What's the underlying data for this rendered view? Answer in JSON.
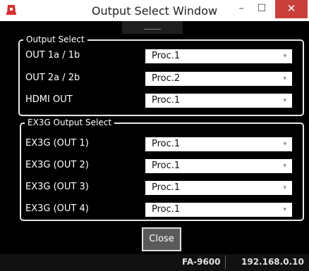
{
  "window": {
    "title": "Output Select Window",
    "controls": {
      "minimize": "–",
      "maximize": "☐",
      "close": "✕"
    }
  },
  "output_select": {
    "legend": "Output Select",
    "rows": [
      {
        "label": "OUT 1a / 1b",
        "value": "Proc.1"
      },
      {
        "label": "OUT 2a / 2b",
        "value": "Proc.2"
      },
      {
        "label": "HDMI OUT",
        "value": "Proc.1"
      }
    ]
  },
  "ex3g_output_select": {
    "legend": "EX3G Output Select",
    "rows": [
      {
        "label": "EX3G (OUT 1)",
        "value": "Proc.1"
      },
      {
        "label": "EX3G (OUT 2)",
        "value": "Proc.1"
      },
      {
        "label": "EX3G (OUT 3)",
        "value": "Proc.1"
      },
      {
        "label": "EX3G (OUT 4)",
        "value": "Proc.1"
      }
    ]
  },
  "close_label": "Close",
  "status": {
    "model": "FA-9600",
    "ip": "192.168.0.10"
  },
  "colors": {
    "accent_close": "#c9403a",
    "logo": "#d32f2f",
    "background": "#000000"
  },
  "icons": {
    "app": "app-logo-icon",
    "dropdown": "chevron-down-icon"
  }
}
